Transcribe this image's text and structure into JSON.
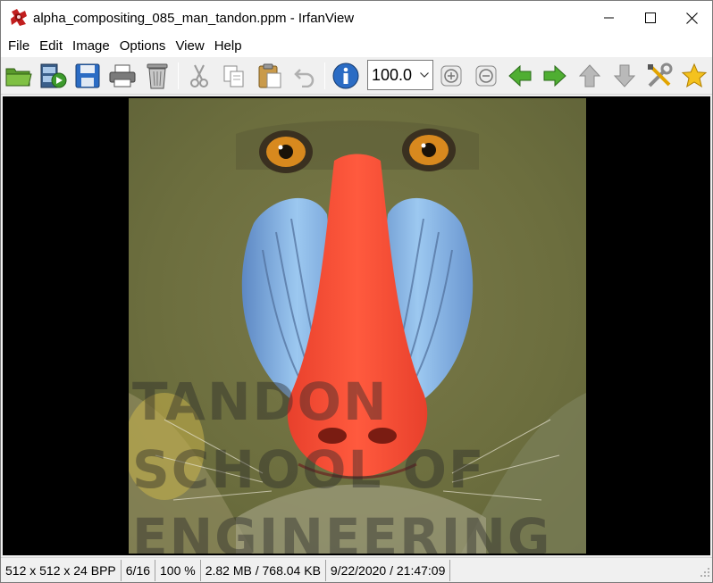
{
  "window": {
    "title": "alpha_compositing_085_man_tandon.ppm - IrfanView",
    "app_icon": "irfanview-icon",
    "controls": [
      "minimize-icon",
      "maximize-icon",
      "close-icon"
    ]
  },
  "menu": {
    "items": [
      "File",
      "Edit",
      "Image",
      "Options",
      "View",
      "Help"
    ]
  },
  "toolbar": {
    "buttons": [
      "open-folder-icon",
      "slideshow-icon",
      "save-icon",
      "print-icon",
      "delete-icon",
      "cut-icon",
      "copy-icon",
      "paste-icon",
      "undo-icon",
      "info-icon",
      "zoom-in-icon",
      "zoom-out-icon",
      "previous-icon",
      "next-icon",
      "up-icon",
      "down-icon",
      "tools-icon",
      "favorite-icon"
    ],
    "zoom_value": "100.0"
  },
  "image": {
    "watermark_lines": [
      "TANDON",
      "SCHOOL OF",
      "ENGINEERING"
    ],
    "background": "#000000"
  },
  "status": {
    "dimensions": "512 x 512 x 24 BPP",
    "index": "6/16",
    "zoom": "100 %",
    "size": "2.82 MB / 768.04 KB",
    "datetime": "9/22/2020 / 21:47:09"
  },
  "colors": {
    "accent_blue": "#2b6cc4",
    "nav_green": "#3c9a2c",
    "mandrill_red": "#ff4a35",
    "mandrill_blue": "#7fb6ea"
  }
}
